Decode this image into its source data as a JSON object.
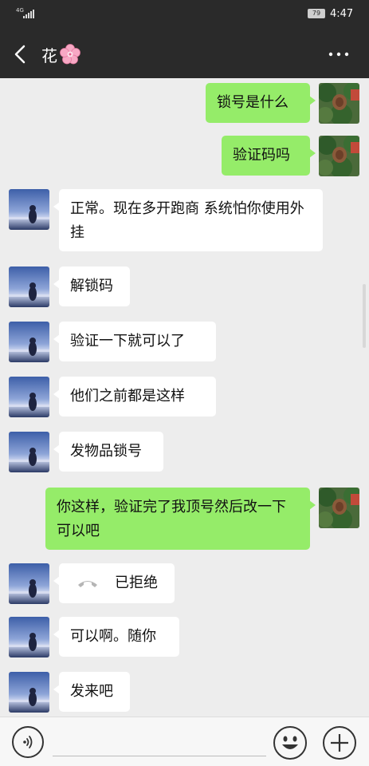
{
  "status_bar": {
    "network": "4G",
    "battery": "79",
    "time": "4:47"
  },
  "header": {
    "title": "花",
    "title_emoji_icon": "cherry-blossom-icon",
    "back_icon": "chevron-left-icon",
    "more_icon": "more-dots-icon"
  },
  "messages": [
    {
      "side": "right",
      "text": "锁号是什么"
    },
    {
      "side": "right",
      "text": "验证码吗"
    },
    {
      "side": "left",
      "text": "正常。现在多开跑商 系统怕你使用外挂"
    },
    {
      "side": "left",
      "text": "解锁码"
    },
    {
      "side": "left",
      "text": "验证一下就可以了"
    },
    {
      "side": "left",
      "text": "他们之前都是这样"
    },
    {
      "side": "left",
      "text": "发物品锁号"
    },
    {
      "side": "right",
      "text": "你这样，验证完了我顶号然后改一下可以吧"
    },
    {
      "side": "left",
      "type": "call",
      "text": "已拒绝",
      "icon": "phone-hangup-icon"
    },
    {
      "side": "left",
      "text": "可以啊。随你"
    },
    {
      "side": "left",
      "text": "发来吧"
    }
  ],
  "input_bar": {
    "voice_icon": "voice-icon",
    "emoji_icon": "emoji-icon",
    "plus_icon": "plus-icon",
    "value": ""
  },
  "colors": {
    "header_bg": "#2a2a2a",
    "chat_bg": "#ededed",
    "self_bubble": "#95ec69",
    "other_bubble": "#ffffff"
  }
}
